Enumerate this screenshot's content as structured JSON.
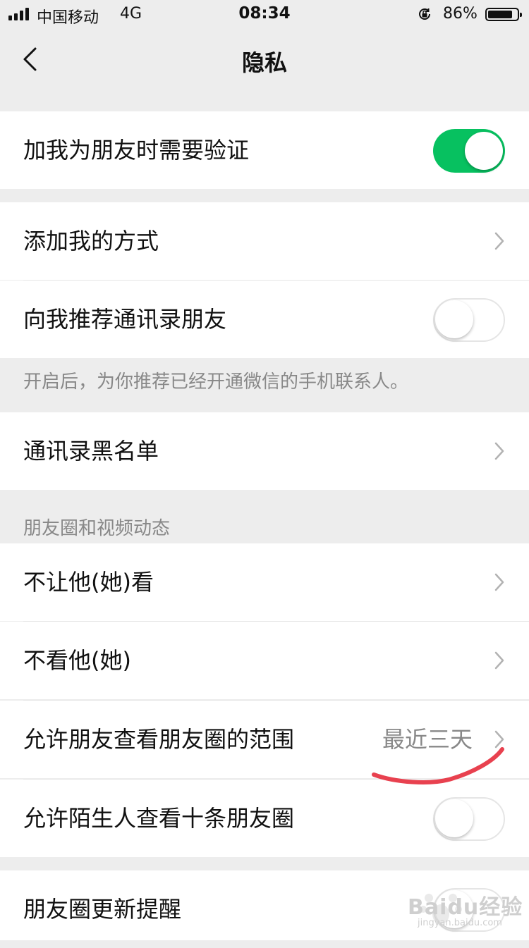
{
  "status_bar": {
    "carrier": "中国移动",
    "network": "4G",
    "time": "08:34",
    "battery": "86%",
    "battery_level": 0.86,
    "icons": [
      "signal-icon",
      "orientation-lock-icon",
      "battery-icon"
    ]
  },
  "nav": {
    "title": "隐私",
    "back_icon": "back-chevron-icon"
  },
  "rows": {
    "friend_verify": {
      "label": "加我为朋友时需要验证",
      "switch_on": true
    },
    "add_methods": {
      "label": "添加我的方式"
    },
    "recommend_contacts": {
      "label": "向我推荐通讯录朋友",
      "switch_on": false
    },
    "recommend_hint": "开启后，为你推荐已经开通微信的手机联系人。",
    "contacts_blacklist": {
      "label": "通讯录黑名单"
    },
    "moments_section_header": "朋友圈和视频动态",
    "hide_my_posts": {
      "label": "不让他(她)看"
    },
    "hide_their_posts": {
      "label": "不看他(她)"
    },
    "moments_range": {
      "label": "允许朋友查看朋友圈的范围",
      "value": "最近三天"
    },
    "stranger_view": {
      "label": "允许陌生人查看十条朋友圈",
      "switch_on": false
    },
    "moments_update": {
      "label": "朋友圈更新提醒"
    }
  },
  "watermark": {
    "brand": "Baidu经验",
    "url": "jingyan.baidu.com"
  },
  "colors": {
    "accent_green": "#07c160",
    "background": "#ededed",
    "annotation_red": "#e8414f"
  }
}
